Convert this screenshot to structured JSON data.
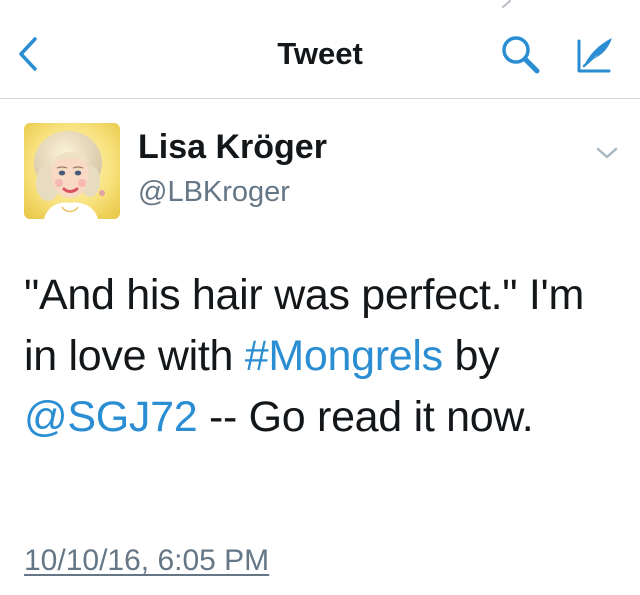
{
  "nav": {
    "title": "Tweet",
    "back_icon": "chevron-left-icon",
    "search_icon": "search-icon",
    "compose_icon": "compose-quill-icon",
    "accent": "#2b8ed3"
  },
  "tweet": {
    "author_name": "Lisa Kröger",
    "author_handle": "@LBKroger",
    "text_parts": {
      "p1": "\"And his hair was perfect.\" I'm in love with ",
      "hashtag": "#Mongrels",
      "p2": " by ",
      "mention": "@SGJ72",
      "p3": " -- Go read it now."
    },
    "timestamp": "10/10/16, 6:05 PM",
    "menu_icon": "chevron-down-icon"
  },
  "colors": {
    "text": "#14171a",
    "secondary": "#657786",
    "link": "#2b8ed3",
    "divider": "#cfd4d8"
  }
}
